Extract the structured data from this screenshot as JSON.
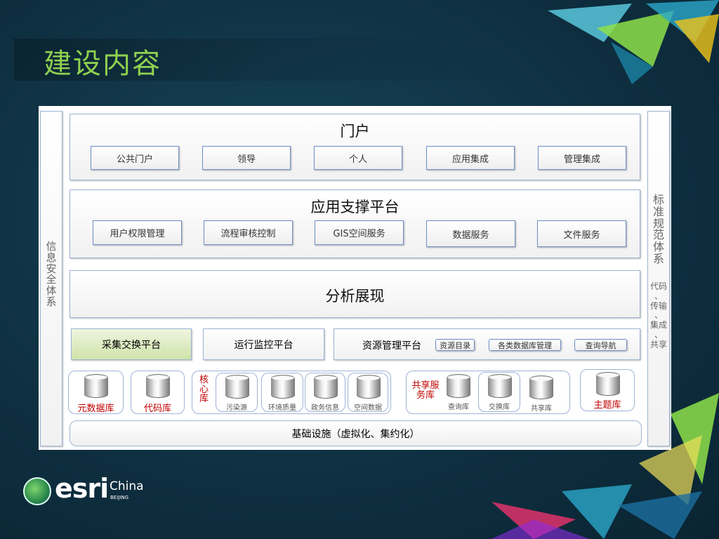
{
  "title": "建设内容",
  "left_column": "信息安全体系",
  "right_column": {
    "title": "标准规范体系",
    "sub": [
      "代码",
      "、",
      "传输",
      "、",
      "集成",
      "、",
      "共享"
    ]
  },
  "portal": {
    "title": "门户",
    "items": [
      "公共门户",
      "领导",
      "个人",
      "应用集成",
      "管理集成"
    ]
  },
  "support": {
    "title": "应用支撑平台",
    "items": [
      "用户权限管理",
      "流程审核控制",
      "GIS空间服务",
      "数据服务",
      "文件服务"
    ]
  },
  "analysis": {
    "title": "分析展现"
  },
  "platforms": {
    "collect": "采集交换平台",
    "monitor": "运行监控平台",
    "resource": {
      "title": "资源管理平台",
      "items": [
        "资源目录",
        "各类数据库管理",
        "查询导航"
      ]
    }
  },
  "databases": {
    "meta": "元数据库",
    "code": "代码库",
    "core": {
      "title": "核心库",
      "items": [
        "污染源",
        "环境质量",
        "政务信息",
        "空间数据"
      ]
    },
    "shared": {
      "title": "共享服务库",
      "items": [
        "查询库",
        "交换库",
        "共享库"
      ]
    },
    "topic": "主题库"
  },
  "infrastructure": "基础设施（虚拟化、集约化）",
  "logo": {
    "brand": "esri",
    "region": "China",
    "city": "BEIJING"
  }
}
